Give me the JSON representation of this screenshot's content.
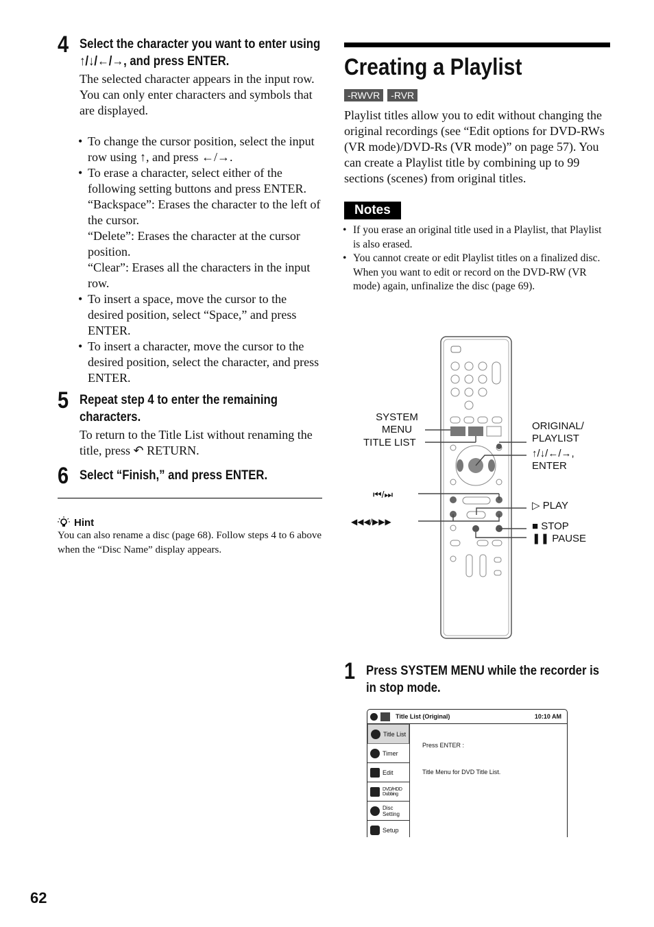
{
  "page_number": "62",
  "left": {
    "step4": {
      "num": "4",
      "head": "Select the character you want to enter using ↑/↓/←/→, and press ENTER.",
      "p1": "The selected character appears in the input row.",
      "p2": "You can only enter characters and symbols that are displayed.",
      "bullets": [
        "To change the cursor position, select the input row using ↑, and press ←/→.",
        "To erase a character, select either of the following setting buttons and press ENTER.",
        "To insert a space, move the cursor to the desired position, select “Space,” and press ENTER.",
        "To insert a character, move the cursor to the desired position, select the character, and press ENTER."
      ],
      "erase_sub": [
        "“Backspace”: Erases the character to the left of the cursor.",
        "“Delete”: Erases the character at the cursor position.",
        "“Clear”: Erases all the characters in the input row."
      ]
    },
    "step5": {
      "num": "5",
      "head": "Repeat step 4 to enter the remaining characters.",
      "p1": "To return to the Title List without renaming the title, press ↶ RETURN."
    },
    "step6": {
      "num": "6",
      "head": "Select “Finish,” and press ENTER."
    },
    "hint": {
      "title": "Hint",
      "text": "You can also rename a disc (page 68). Follow steps 4 to 6 above when the “Disc Name” display appears."
    }
  },
  "right": {
    "title": "Creating a Playlist",
    "badges": [
      "-RWVR",
      "-RVR"
    ],
    "intro": "Playlist titles allow you to edit without changing the original recordings (see “Edit options for DVD-RWs (VR mode)/DVD-Rs (VR mode)” on page 57). You can create a Playlist title by combining up to 99 sections (scenes) from original titles.",
    "notes_label": "Notes",
    "notes": [
      "If you erase an original title used in a Playlist, that Playlist is also erased.",
      "You cannot create or edit Playlist titles on a finalized disc. When you want to edit or record on the DVD-RW (VR mode) again, unfinalize the disc (page 69)."
    ],
    "remote_labels": {
      "system_menu": "SYSTEM MENU",
      "title_list": "TITLE LIST",
      "original_playlist": "ORIGINAL/ PLAYLIST",
      "arrows_enter": "↑/↓/←/→, ENTER",
      "skip": "⏮/⏭",
      "scan": "◀◀◀/▶▶▶",
      "play": "▷ PLAY",
      "stop": "■ STOP",
      "pause": "❚❚ PAUSE"
    },
    "step1": {
      "num": "1",
      "head": "Press SYSTEM MENU while the recorder is in stop mode."
    },
    "screen": {
      "header_title": "Title List (Original)",
      "time": "10:10 AM",
      "menu": [
        "Title List",
        "Timer",
        "Edit",
        "DVD/HDD Dubbing",
        "Disc Setting",
        "Setup"
      ],
      "msg1": "Press ENTER :",
      "msg2": "Title Menu for DVD Title List."
    }
  }
}
